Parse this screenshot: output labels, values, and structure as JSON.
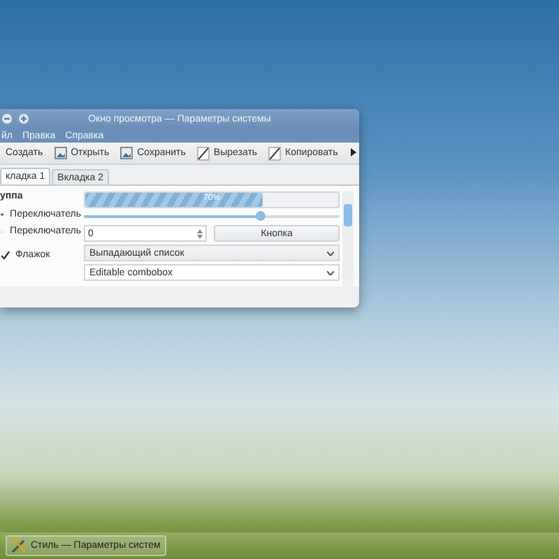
{
  "window": {
    "title": "Окно просмотра — Параметры системы",
    "menu": [
      {
        "label": "йл"
      },
      {
        "label": "Правка"
      },
      {
        "label": "Справка"
      }
    ],
    "toolbar": [
      {
        "label": "Создать",
        "kind": "plain"
      },
      {
        "label": "Открыть",
        "kind": "picture"
      },
      {
        "label": "Сохранить",
        "kind": "picture"
      },
      {
        "label": "Вырезать",
        "kind": "pen"
      },
      {
        "label": "Копировать",
        "kind": "pen"
      }
    ],
    "tabs": [
      {
        "label": "кладка 1",
        "selected": true
      },
      {
        "label": "Вкладка 2",
        "selected": false
      }
    ],
    "group": {
      "title": "уппа",
      "radios": [
        {
          "label": "Переключатель",
          "selected": true
        },
        {
          "label": "Переключатель",
          "selected": false
        }
      ],
      "checkbox": {
        "label": "Флажок",
        "checked": true
      }
    },
    "progress": {
      "level": 0.7,
      "reading": "70%"
    },
    "slider": {
      "level": 0.69
    },
    "spinbox": {
      "value": "0"
    },
    "button": {
      "label": "Кнопка"
    },
    "combo": {
      "value": "Выпадающий список"
    },
    "editable_combo": {
      "value": "Editable combobox"
    }
  },
  "taskbar": {
    "tasks": [
      {
        "label": "Стиль — Параметры систем"
      }
    ]
  }
}
